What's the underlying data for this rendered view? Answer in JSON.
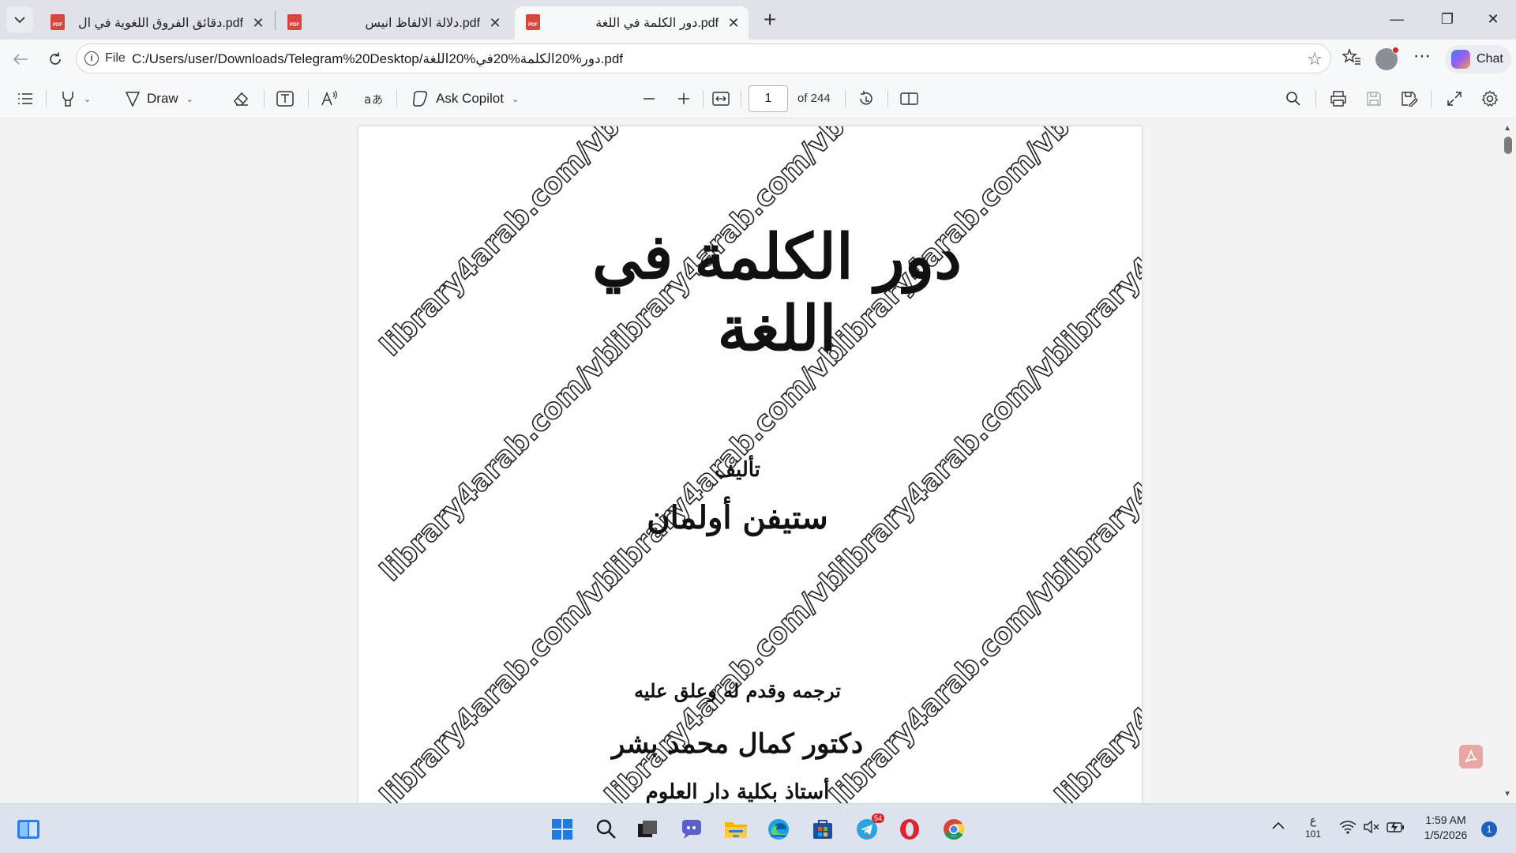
{
  "tabs": [
    {
      "title": "دقائق الفروق اللغوية في ال.pdf",
      "close": "✕",
      "icon_label": "PDF"
    },
    {
      "title": "دلالة الالفاظ انيس.pdf",
      "close": "✕",
      "icon_label": "PDF"
    },
    {
      "title": "دور الكلمة في اللغة.pdf",
      "close": "✕",
      "icon_label": "PDF"
    }
  ],
  "new_tab": "+",
  "window": {
    "minimize": "—",
    "maximize": "❐",
    "close": "✕"
  },
  "address": {
    "scheme": "File",
    "url": "C:/Users/user/Downloads/Telegram%20Desktop/دور%20الكلمة%20في%20اللغة.pdf"
  },
  "chat_label": "Chat",
  "toolbar": {
    "draw_label": "Draw",
    "copilot_label": "Ask Copilot",
    "page_current": "1",
    "page_total": "of 244"
  },
  "document": {
    "title": "دور الكلمة في اللغة",
    "by_label": "تأليف",
    "author": "ستيفن أولمان",
    "translator_line": "ترجمه وقدم له وعلق عليه",
    "translator": "دكتور كمال محمد بشر",
    "translator_role": "أستاذ بكلية دار العلوم",
    "watermark": "library4arab.com/vb"
  },
  "taskbar": {
    "telegram_badge": "54",
    "lang_top": "ع",
    "lang_bottom": "101",
    "time": "1:59 AM",
    "date": "1/5/2026",
    "notification_count": "1"
  }
}
